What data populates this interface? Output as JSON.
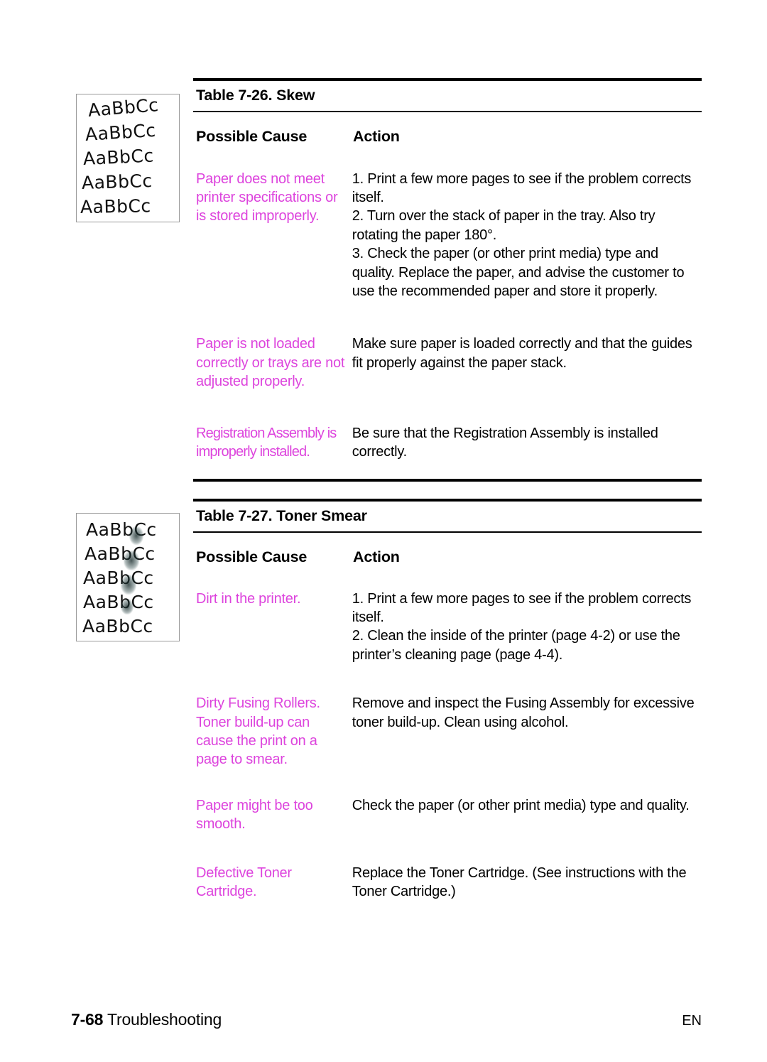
{
  "page": {
    "footer": {
      "page_number": "7-68",
      "section": "Troubleshooting",
      "language": "EN"
    }
  },
  "illustrations": [
    {
      "name": "skew-sample-image",
      "defect": "skew",
      "sample_text": "AaBbCc",
      "line_count": 5,
      "lines": [
        "AaBbCc",
        "AaBbCc",
        "AaBbCc",
        "AaBbCc",
        "AaBbCc"
      ]
    },
    {
      "name": "toner-smear-sample-image",
      "defect": "toner smear",
      "sample_text": "AaBbCc",
      "line_count": 5,
      "lines": [
        "AaBbCc",
        "AaBbCc",
        "AaBbCc",
        "AaBbCc",
        "AaBbCc"
      ]
    }
  ],
  "tables": [
    {
      "title": "Table 7-26. Skew",
      "columns": [
        "Possible Cause",
        "Action"
      ],
      "rows": [
        {
          "cause": "Paper does not meet printer specifications or is stored improperly.",
          "action": "1. Print a few more pages to see if the problem corrects itself.\n2. Turn over the stack of paper in the tray. Also try rotating the paper 180°.\n3. Check the paper (or other print media) type and quality. Replace the paper, and advise the customer to use the recommended paper and store it properly."
        },
        {
          "cause": "Paper is not loaded correctly or trays are not adjusted properly.",
          "action": "Make sure paper is loaded correctly and that the guides fit properly against the paper stack."
        },
        {
          "cause": "Registration Assembly is improperly installed.",
          "action": "Be sure that the Registration Assembly is installed correctly."
        }
      ]
    },
    {
      "title": "Table 7-27. Toner Smear",
      "columns": [
        "Possible Cause",
        "Action"
      ],
      "rows": [
        {
          "cause": "Dirt in the printer.",
          "action": "1. Print a few more pages to see if the problem corrects itself.\n2. Clean the inside of the printer (page 4-2) or use the printer’s cleaning page (page 4-4)."
        },
        {
          "cause": "Dirty Fusing Rollers. Toner build-up can cause the print on a page to smear.",
          "action": "Remove and inspect the Fusing Assembly for excessive toner build-up. Clean using alcohol."
        },
        {
          "cause": "Paper might be too smooth.",
          "action": "Check the paper (or other print media) type and quality."
        },
        {
          "cause": "Defective Toner Cartridge.",
          "action": "Replace the Toner Cartridge. (See instructions with the Toner Cartridge.)"
        }
      ]
    }
  ],
  "colors": {
    "cause_text": "#dd44dd",
    "body_text": "#000000",
    "rule": "#000000",
    "image_border": "#9a9a9a"
  }
}
